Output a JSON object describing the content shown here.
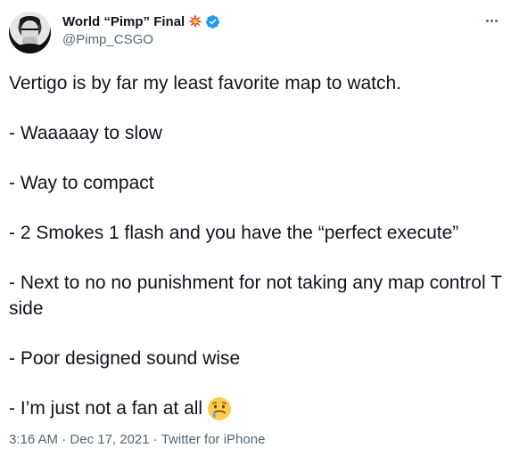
{
  "author": {
    "display_name": "World “Pimp” Final",
    "handle": "@Pimp_CSGO",
    "name_emoji_icon": "collision-emoji-icon",
    "verified_icon": "verified-badge-icon",
    "verified_color": "#1d9bf0"
  },
  "tweet": {
    "lines": [
      "Vertigo is by far my least favorite map to watch.",
      "- Waaaaay to slow",
      "- Way to compact",
      "- 2 Smokes 1 flash and you have the “perfect execute”",
      "- Next to no no punishment for not taking any map control T side",
      "- Poor designed sound wise",
      "- I’m just not a fan at all"
    ],
    "final_emoji_icon": "crying-face-emoji-icon"
  },
  "meta": {
    "time": "3:16 AM",
    "separator_1": " · ",
    "date": "Dec 17, 2021",
    "separator_2": " · ",
    "source": "Twitter for iPhone"
  },
  "colors": {
    "text": "#0f1419",
    "secondary": "#536471",
    "accent": "#1d9bf0"
  }
}
